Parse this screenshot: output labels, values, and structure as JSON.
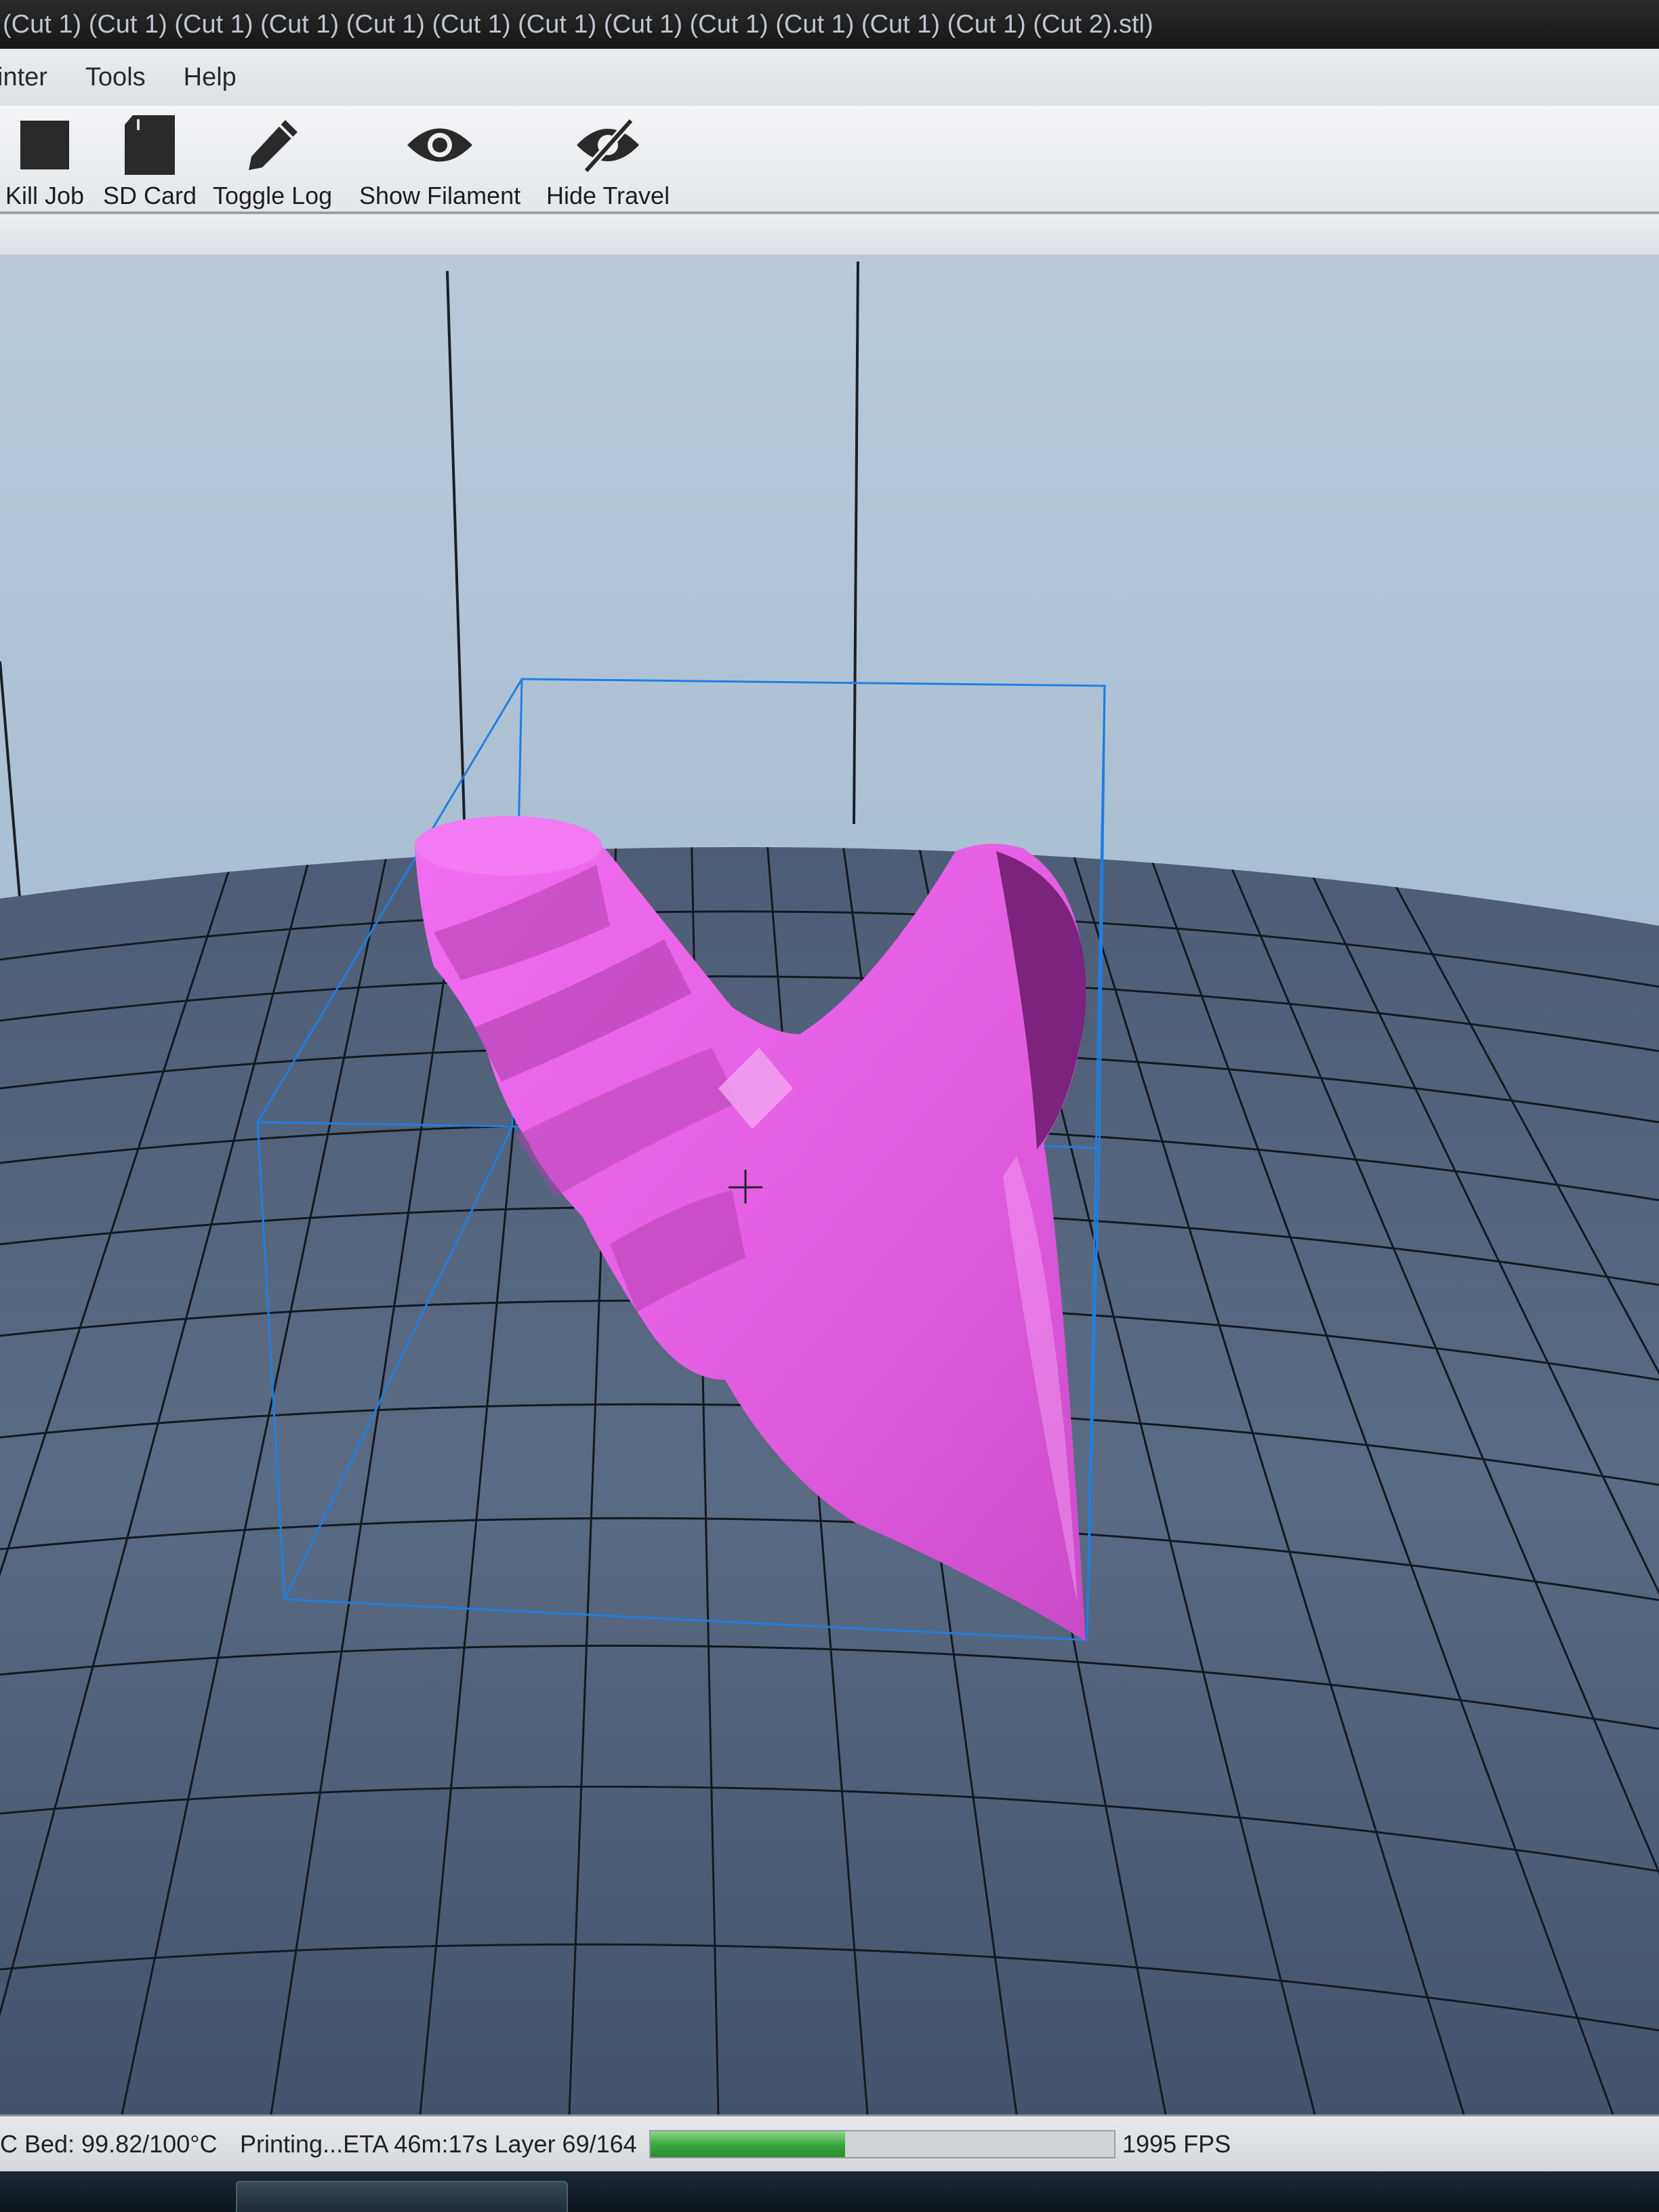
{
  "window": {
    "title": "(Cut 1) (Cut 1) (Cut 1) (Cut 1) (Cut 1) (Cut 1) (Cut 1) (Cut 1) (Cut 1) (Cut 1) (Cut 1) (Cut 1) (Cut 2).stl)"
  },
  "menu": {
    "items": [
      {
        "label": "inter"
      },
      {
        "label": "Tools"
      },
      {
        "label": "Help"
      }
    ]
  },
  "toolbar": {
    "buttons": [
      {
        "label": "Kill Job",
        "icon": "stop-square-icon"
      },
      {
        "label": "SD Card",
        "icon": "sd-card-icon"
      },
      {
        "label": "Toggle Log",
        "icon": "pencil-icon"
      },
      {
        "label": "Show Filament",
        "icon": "eye-icon"
      },
      {
        "label": "Hide Travel",
        "icon": "eye-slash-icon"
      }
    ]
  },
  "viewport": {
    "model_color": "#e060e0",
    "bed_color": "#4a5a72",
    "bounding_box_color": "#1e88ff"
  },
  "status": {
    "bed": "C Bed: 99.82/100°C",
    "printing": "Printing...ETA 46m:17s Layer 69/164",
    "progress": 0.42,
    "fps": "1995 FPS"
  },
  "colors": {
    "accent_progress": "#33a63a"
  }
}
